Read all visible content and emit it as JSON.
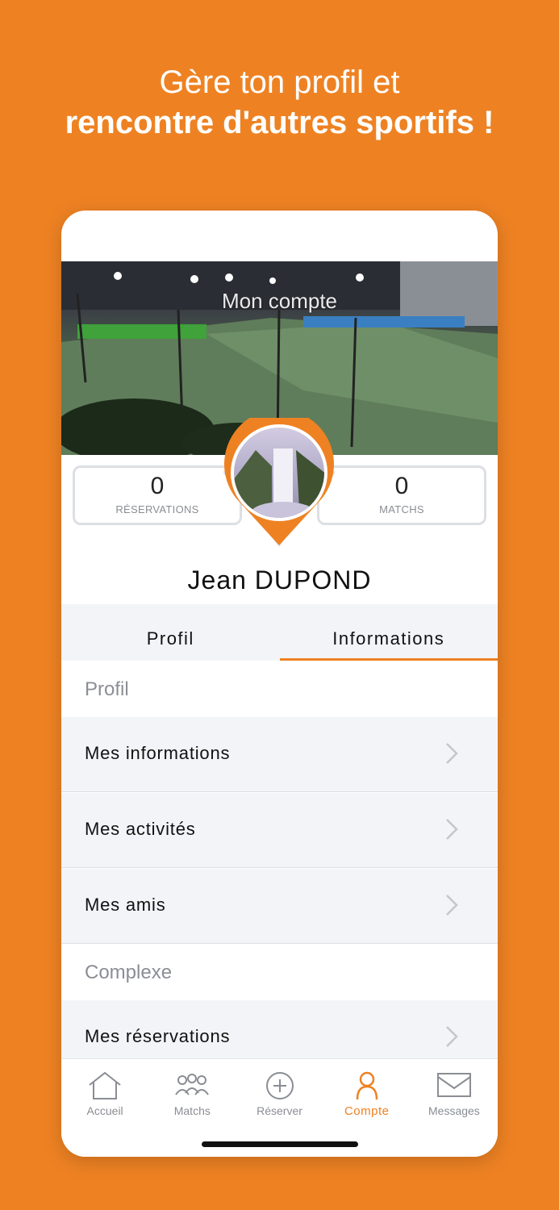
{
  "headline": {
    "line1": "Gère ton profil et",
    "line2": "rencontre d'autres sportifs !"
  },
  "hero": {
    "title": "Mon compte"
  },
  "stats": {
    "reservations": {
      "value": "0",
      "label": "RÉSERVATIONS"
    },
    "matchs": {
      "value": "0",
      "label": "MATCHS"
    }
  },
  "user": {
    "name": "Jean  DUPOND"
  },
  "tabs": [
    {
      "label": "Profil"
    },
    {
      "label": "Informations",
      "active": true
    }
  ],
  "sections": {
    "profil": {
      "header": "Profil",
      "items": [
        {
          "label": "Mes informations"
        },
        {
          "label": "Mes activités"
        },
        {
          "label": "Mes amis"
        }
      ]
    },
    "complexe": {
      "header": "Complexe",
      "items": [
        {
          "label": "Mes réservations"
        }
      ]
    }
  },
  "tabbar": [
    {
      "label": "Accueil",
      "icon": "home-icon"
    },
    {
      "label": "Matchs",
      "icon": "people-icon"
    },
    {
      "label": "Réserver",
      "icon": "plus-circle-icon"
    },
    {
      "label": "Compte",
      "icon": "user-icon",
      "active": true
    },
    {
      "label": "Messages",
      "icon": "mail-icon"
    }
  ],
  "colors": {
    "accent": "#ee8223",
    "background": "#ee8223",
    "row_bg": "#f3f4f8"
  }
}
